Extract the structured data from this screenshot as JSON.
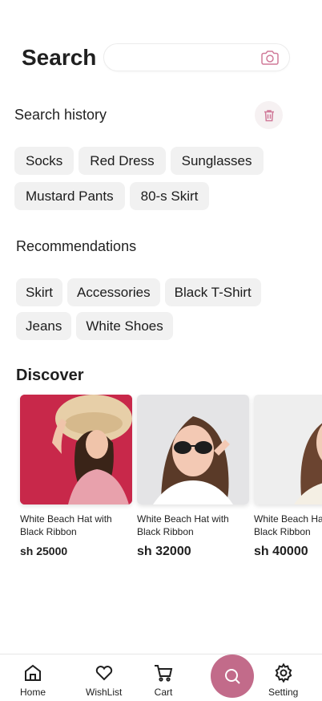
{
  "header": {
    "title": "Search",
    "search_placeholder": ""
  },
  "history": {
    "title": "Search history",
    "items": [
      "Socks",
      "Red Dress",
      "Sunglasses",
      "Mustard Pants",
      "80-s Skirt"
    ]
  },
  "recommendations": {
    "title": "Recommendations",
    "items": [
      "Skirt",
      "Accessories",
      "Black T-Shirt",
      "Jeans",
      "White Shoes"
    ]
  },
  "discover": {
    "title": "Discover",
    "products": [
      {
        "name": "White Beach Hat with Black Ribbon",
        "price": "sh 25000"
      },
      {
        "name": "White Beach Hat with Black Ribbon",
        "price": "sh 32000"
      },
      {
        "name": "White Beach Hat with Black Ribbon",
        "price": "sh 40000"
      }
    ]
  },
  "nav": {
    "items": [
      {
        "label": "Home",
        "icon": "home-icon"
      },
      {
        "label": "WishList",
        "icon": "heart-icon"
      },
      {
        "label": "Cart",
        "icon": "cart-icon"
      },
      {
        "label": "",
        "icon": "search-icon"
      },
      {
        "label": "Setting",
        "icon": "gear-icon"
      }
    ]
  },
  "colors": {
    "accent": "#c26b8a",
    "chip_bg": "#f1f1f1",
    "text": "#1f1f1f"
  }
}
